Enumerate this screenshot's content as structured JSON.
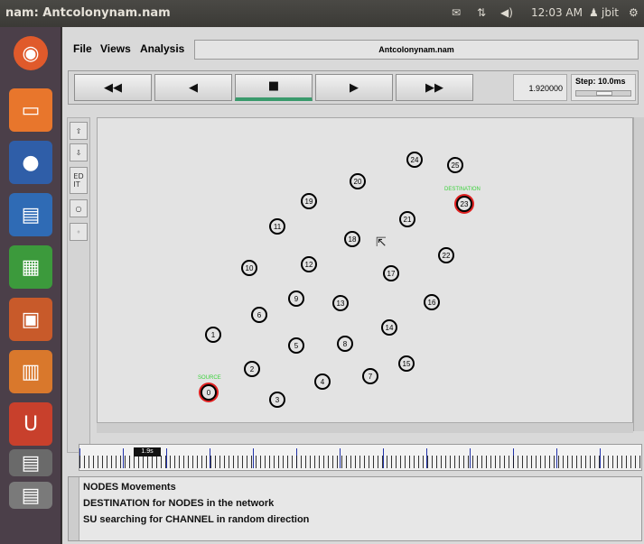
{
  "topbar": {
    "title": "nam: Antcolonynam.nam",
    "mail_icon": "mail-icon",
    "network_icon": "network-icon",
    "volume_icon": "volume-icon",
    "clock": "12:03 AM",
    "user": "jbit",
    "gear_icon": "gear-icon"
  },
  "menu": {
    "file": "File",
    "views": "Views",
    "analysis": "Analysis",
    "filename": "Antcolonynam.nam"
  },
  "controls": {
    "rewind": "◀◀",
    "back": "◀",
    "stop": "■",
    "play": "▶",
    "fastforward": "▶▶",
    "time": "1.920000",
    "step": "Step: 10.0ms",
    "step_level": 0.5
  },
  "tools": {
    "edit": "ED\nIT"
  },
  "nodes": [
    {
      "id": "0",
      "label": "SOURCE"
    },
    {
      "id": "1"
    },
    {
      "id": "2"
    },
    {
      "id": "3"
    },
    {
      "id": "4"
    },
    {
      "id": "5"
    },
    {
      "id": "6"
    },
    {
      "id": "7"
    },
    {
      "id": "8"
    },
    {
      "id": "9"
    },
    {
      "id": "10"
    },
    {
      "id": "11"
    },
    {
      "id": "12"
    },
    {
      "id": "13"
    },
    {
      "id": "14"
    },
    {
      "id": "15"
    },
    {
      "id": "16"
    },
    {
      "id": "17"
    },
    {
      "id": "18"
    },
    {
      "id": "19"
    },
    {
      "id": "20"
    },
    {
      "id": "21"
    },
    {
      "id": "22"
    },
    {
      "id": "23",
      "label": "DESTINATION"
    },
    {
      "id": "24"
    },
    {
      "id": "25"
    }
  ],
  "timeline": {
    "marker": "1.9s"
  },
  "messages": [
    "NODES Movements",
    "DESTINATION for NODES in the network",
    "SU searching for CHANNEL in random direction"
  ],
  "colors": {
    "accent_active": "#3a9a6c",
    "destination_node": "#e02020",
    "label_green": "#3bd23b"
  }
}
